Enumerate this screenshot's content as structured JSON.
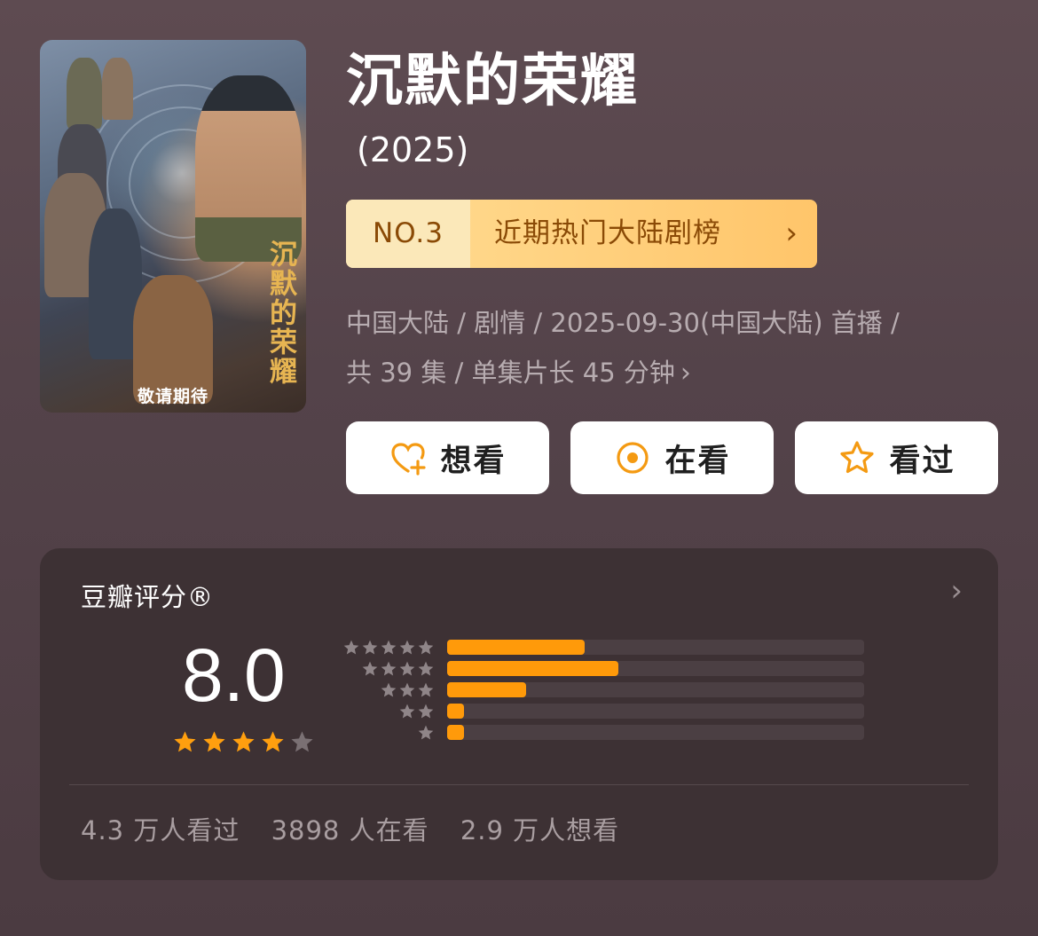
{
  "poster": {
    "vertical_title": "沉默的荣耀",
    "tagline": "敬请期待"
  },
  "show": {
    "title": "沉默的荣耀",
    "year": "(2025)"
  },
  "rank": {
    "number": "NO.3",
    "list_name": "近期热门大陆剧榜",
    "chevron": "›"
  },
  "meta": {
    "line1": "中国大陆 / 剧情 / 2025-09-30(中国大陆) 首播 /",
    "line2": "共 39 集 / 单集片长 45 分钟",
    "more": "›"
  },
  "actions": {
    "want": {
      "label": "想看",
      "icon": "heart-plus-icon"
    },
    "watching": {
      "label": "在看",
      "icon": "target-icon"
    },
    "watched": {
      "label": "看过",
      "icon": "star-outline-icon"
    }
  },
  "rating": {
    "title": "豆瓣评分®",
    "chevron": "›",
    "score": "8.0",
    "stars": 4,
    "distribution": [
      {
        "stars": 5,
        "fraction": 0.33
      },
      {
        "stars": 4,
        "fraction": 0.41
      },
      {
        "stars": 3,
        "fraction": 0.19
      },
      {
        "stars": 2,
        "fraction": 0.04
      },
      {
        "stars": 1,
        "fraction": 0.04
      }
    ],
    "stats": {
      "watched": "4.3 万人看过",
      "watching": "3898 人在看",
      "want": "2.9 万人想看"
    }
  },
  "colors": {
    "accent": "#ff9a0a",
    "star_fill": "#ff9f0f",
    "star_empty": "#7a7073",
    "rank_text": "#8a4a06"
  }
}
